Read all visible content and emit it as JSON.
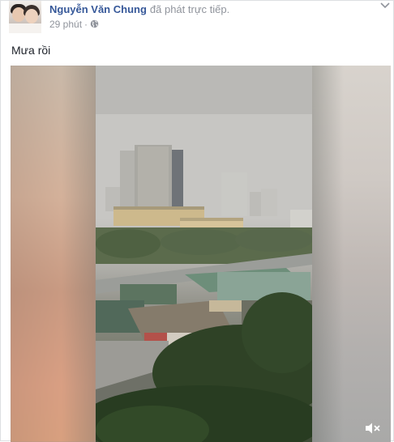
{
  "post": {
    "author": "Nguyễn Văn Chung",
    "action": "đã phát trực tiếp.",
    "time": "29 phút",
    "dot": "·",
    "text": "Mưa rồi"
  },
  "icons": {
    "privacy": "globe-icon",
    "options": "chevron-down-icon",
    "audio": "mute-icon"
  },
  "colors": {
    "author_link": "#365899",
    "meta_text": "#90949c",
    "body_text": "#1d2129"
  }
}
